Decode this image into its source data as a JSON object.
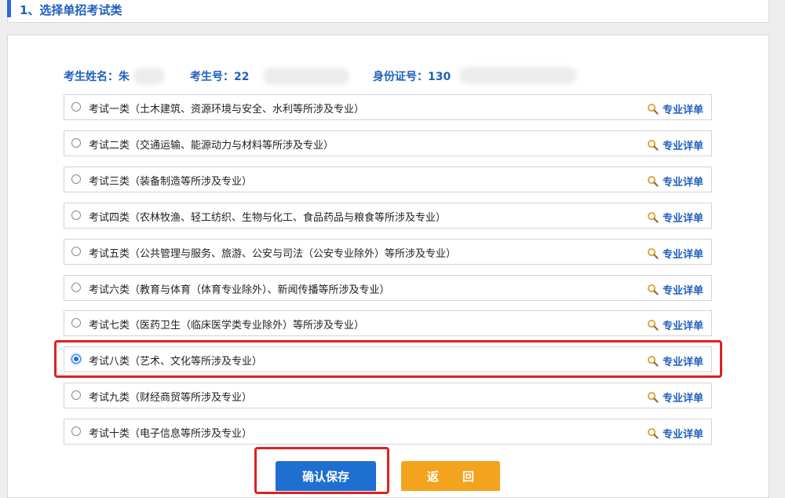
{
  "section": {
    "title": "1、选择单招考试类"
  },
  "student": {
    "name_label": "考生姓名：",
    "name_value": "朱",
    "number_label": "考生号：",
    "number_value": "22",
    "id_label": "身份证号：",
    "id_value": "130"
  },
  "options": [
    {
      "label": "考试一类（土木建筑、资源环境与安全、水利等所涉及专业）",
      "detail": "专业详单",
      "selected": false
    },
    {
      "label": "考试二类（交通运输、能源动力与材料等所涉及专业）",
      "detail": "专业详单",
      "selected": false
    },
    {
      "label": "考试三类（装备制造等所涉及专业）",
      "detail": "专业详单",
      "selected": false
    },
    {
      "label": "考试四类（农林牧渔、轻工纺织、生物与化工、食品药品与粮食等所涉及专业）",
      "detail": "专业详单",
      "selected": false
    },
    {
      "label": "考试五类（公共管理与服务、旅游、公安与司法（公安专业除外）等所涉及专业）",
      "detail": "专业详单",
      "selected": false
    },
    {
      "label": "考试六类（教育与体育（体育专业除外）、新闻传播等所涉及专业）",
      "detail": "专业详单",
      "selected": false
    },
    {
      "label": "考试七类（医药卫生（临床医学类专业除外）等所涉及专业）",
      "detail": "专业详单",
      "selected": false
    },
    {
      "label": "考试八类（艺术、文化等所涉及专业）",
      "detail": "专业详单",
      "selected": true
    },
    {
      "label": "考试九类（财经商贸等所涉及专业）",
      "detail": "专业详单",
      "selected": false
    },
    {
      "label": "考试十类（电子信息等所涉及专业）",
      "detail": "专业详单",
      "selected": false
    }
  ],
  "buttons": {
    "confirm": "确认保存",
    "back": "返　　回"
  },
  "colors": {
    "accent": "#1f5fbf",
    "confirm": "#1e6fd0",
    "back": "#f4a31e",
    "highlight": "#e02020"
  },
  "icons": {
    "detail": "magnifier-icon"
  }
}
